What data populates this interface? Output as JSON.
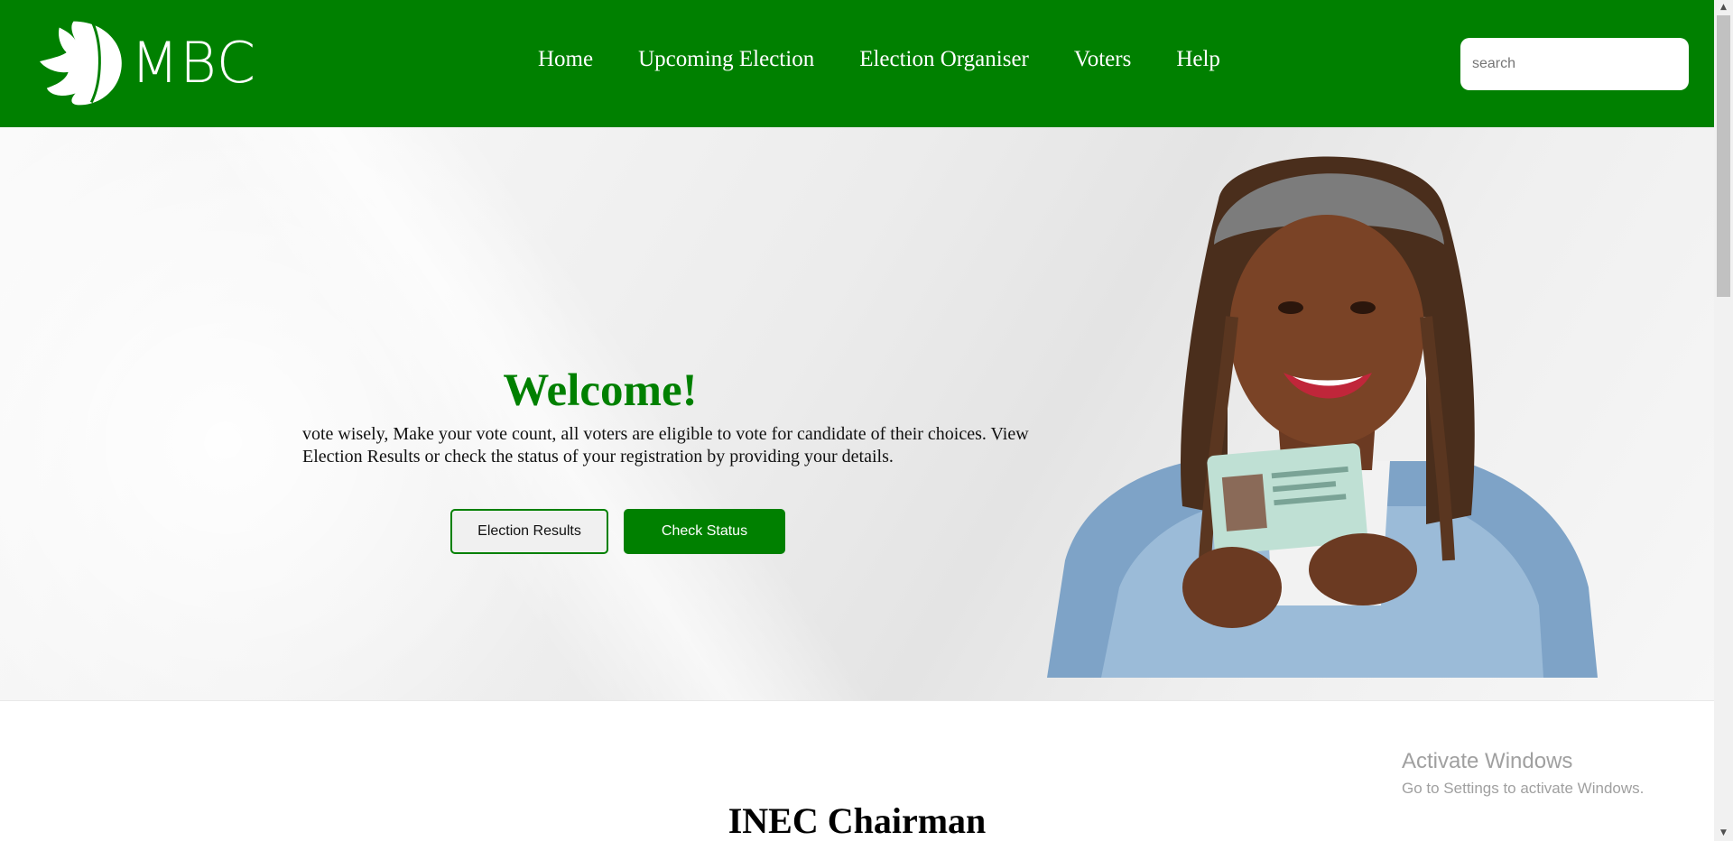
{
  "header": {
    "logo_text": "MBC",
    "nav": [
      "Home",
      "Upcoming Election",
      "Election Organiser",
      "Voters",
      "Help"
    ],
    "search_placeholder": "search"
  },
  "hero": {
    "title": "Welcome!",
    "text": "vote wisely, Make your vote count, all voters are eligible to vote for candidate of their choices. View Election Results or check the status of your registration by providing your details.",
    "buttons": {
      "results": "Election Results",
      "status": "Check Status"
    }
  },
  "section": {
    "title": "INEC Chairman"
  },
  "watermark": {
    "title": "Activate Windows",
    "subtitle": "Go to Settings to activate Windows."
  },
  "colors": {
    "brand_green": "#008000"
  },
  "icons": [
    "leaf-logo-icon",
    "scroll-up-arrow-icon",
    "scroll-down-arrow-icon"
  ]
}
